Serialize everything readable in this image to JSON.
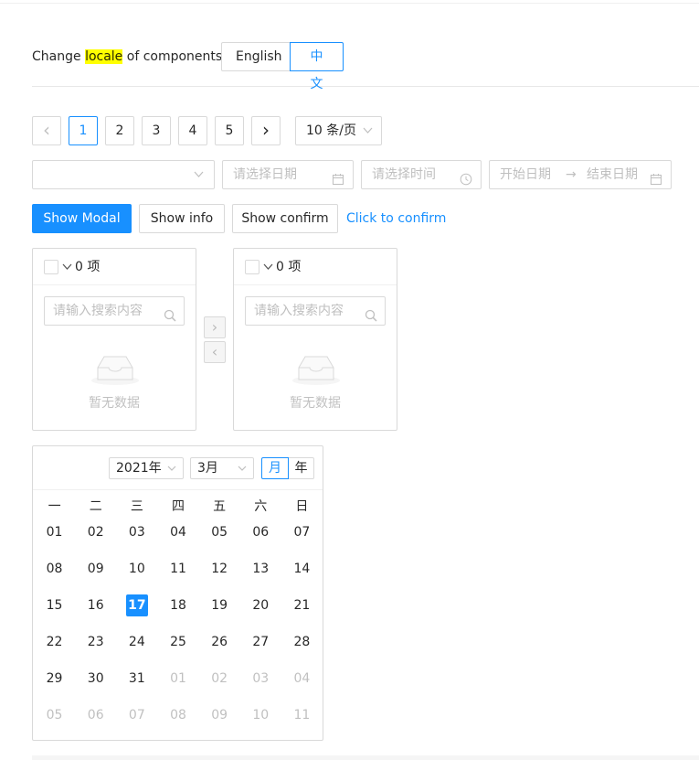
{
  "locale": {
    "label_before": "Change ",
    "label_highlight": "locale",
    "label_after": " of components:",
    "options": [
      "English",
      "中文"
    ],
    "selected": "中文"
  },
  "pagination": {
    "pages": [
      "1",
      "2",
      "3",
      "4",
      "5"
    ],
    "current": "1",
    "prev_icon": "‹",
    "next_icon": "›",
    "page_size": "10 条/页"
  },
  "pickers": {
    "date_placeholder": "请选择日期",
    "time_placeholder": "请选择时间",
    "range_start_placeholder": "开始日期",
    "range_end_placeholder": "结束日期",
    "range_separator": "→"
  },
  "buttons": {
    "show_modal": "Show Modal",
    "show_info": "Show info",
    "show_confirm": "Show confirm",
    "click_to_confirm": "Click to confirm"
  },
  "transfer": {
    "left": {
      "count_label": "0 项",
      "search_placeholder": "请输入搜索内容",
      "empty_text": "暂无数据"
    },
    "right": {
      "count_label": "0 项",
      "search_placeholder": "请输入搜索内容",
      "empty_text": "暂无数据"
    },
    "move_right_icon": "›",
    "move_left_icon": "‹"
  },
  "calendar": {
    "year": "2021年",
    "month": "3月",
    "modes": [
      "月",
      "年"
    ],
    "selected_mode": "月",
    "weekdays": [
      "一",
      "二",
      "三",
      "四",
      "五",
      "六",
      "日"
    ],
    "weeks": [
      [
        {
          "d": "01"
        },
        {
          "d": "02"
        },
        {
          "d": "03"
        },
        {
          "d": "04"
        },
        {
          "d": "05"
        },
        {
          "d": "06"
        },
        {
          "d": "07"
        }
      ],
      [
        {
          "d": "08"
        },
        {
          "d": "09"
        },
        {
          "d": "10"
        },
        {
          "d": "11"
        },
        {
          "d": "12"
        },
        {
          "d": "13"
        },
        {
          "d": "14"
        }
      ],
      [
        {
          "d": "15"
        },
        {
          "d": "16"
        },
        {
          "d": "17",
          "today": true
        },
        {
          "d": "18"
        },
        {
          "d": "19"
        },
        {
          "d": "20"
        },
        {
          "d": "21"
        }
      ],
      [
        {
          "d": "22"
        },
        {
          "d": "23"
        },
        {
          "d": "24"
        },
        {
          "d": "25"
        },
        {
          "d": "26"
        },
        {
          "d": "27"
        },
        {
          "d": "28"
        }
      ],
      [
        {
          "d": "29"
        },
        {
          "d": "30"
        },
        {
          "d": "31"
        },
        {
          "d": "01",
          "out": true
        },
        {
          "d": "02",
          "out": true
        },
        {
          "d": "03",
          "out": true
        },
        {
          "d": "04",
          "out": true
        }
      ],
      [
        {
          "d": "05",
          "out": true
        },
        {
          "d": "06",
          "out": true
        },
        {
          "d": "07",
          "out": true
        },
        {
          "d": "08",
          "out": true
        },
        {
          "d": "09",
          "out": true
        },
        {
          "d": "10",
          "out": true
        },
        {
          "d": "11",
          "out": true
        }
      ]
    ]
  },
  "colors": {
    "primary": "#1890ff",
    "highlight": "#ffff00",
    "border": "#d9d9d9"
  }
}
